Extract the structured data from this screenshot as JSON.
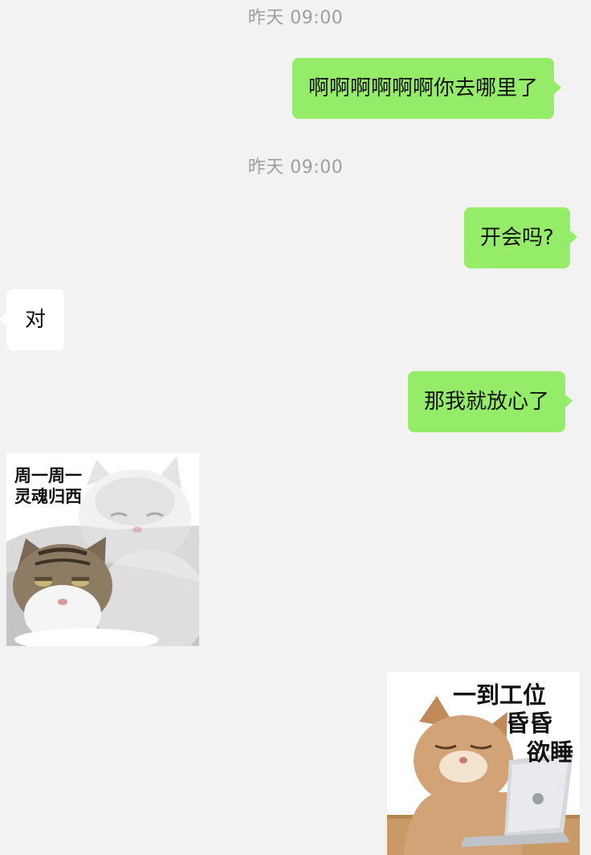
{
  "messages": {
    "ts1": "昨天 09:00",
    "msg1": "啊啊啊啊啊啊你去哪里了",
    "ts2": "昨天 09:00",
    "msg2": "开会吗?",
    "msg3": "对",
    "msg4": "那我就放心了",
    "sticker1": {
      "line1": "周一周一",
      "line2": "灵魂归西"
    },
    "sticker2": {
      "line1": "一到工位",
      "line2": "昏昏",
      "line3": "欲睡"
    }
  },
  "colors": {
    "background": "#f2f2f2",
    "outgoing_bubble": "#95ec69",
    "incoming_bubble": "#ffffff",
    "timestamp_text": "#9e9e9e"
  }
}
